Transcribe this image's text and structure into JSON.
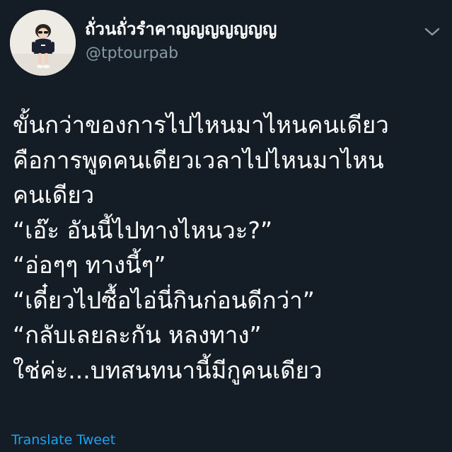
{
  "author": {
    "display_name": "ถั่วนถั่วรำคาญญญญญญญ",
    "handle": "@tptourpab",
    "avatar_icon": "profile-photo-child"
  },
  "menu": {
    "icon": "chevron-down-icon"
  },
  "tweet": {
    "lines": [
      "ขั้นกว่าของการไปไหนมาไหนคนเดียว",
      "คือการพูดคนเดียวเวลาไปไหนมาไหน",
      "คนเดียว",
      "“เอ๊ะ อันนี้ไปทางไหนวะ?”",
      "“อ่อๆๆ ทางนี้ๆ”",
      "“เดี๋ยวไปซื้อไอ่นี่กินก่อนดีกว่า”",
      "“กลับเลยละกัน หลงทาง”",
      "ใช่ค่ะ...บทสนทนานี้มีกูคนเดียว"
    ]
  },
  "actions": {
    "translate_label": "Translate Tweet"
  },
  "colors": {
    "background": "#141d26",
    "text": "#ffffff",
    "secondary_text": "#8899a6",
    "link": "#1da1f2"
  }
}
